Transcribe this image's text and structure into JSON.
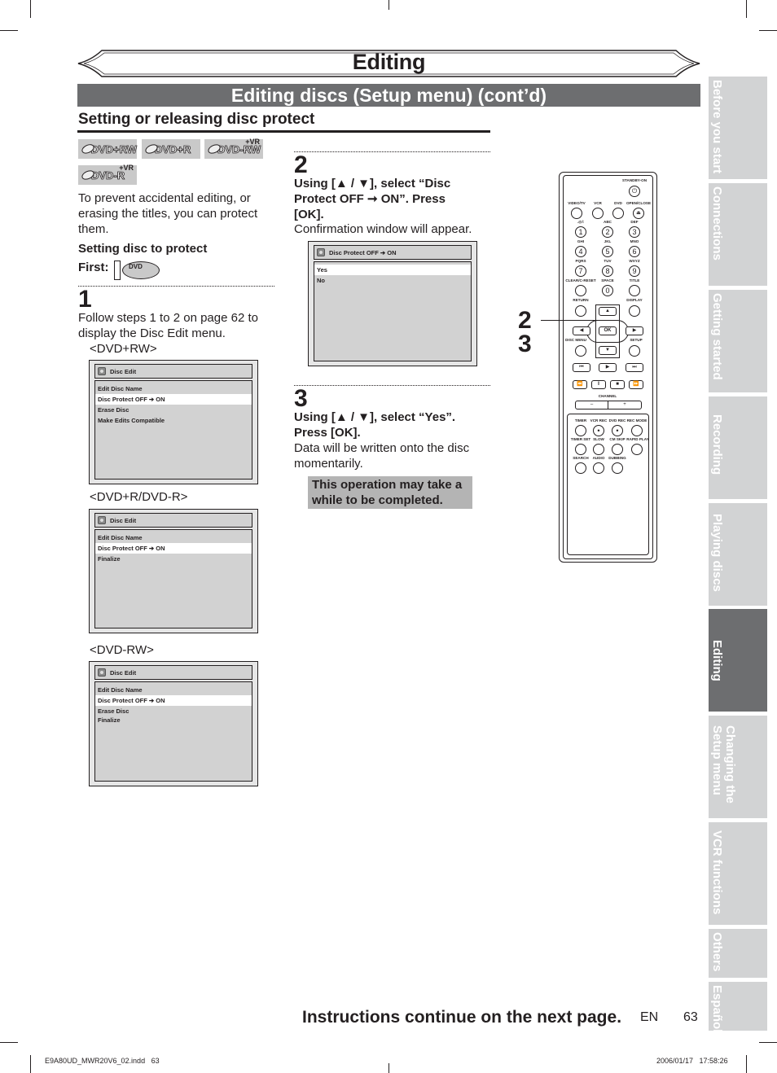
{
  "page": {
    "chapter_title": "Editing",
    "section_title": "Editing discs (Setup menu) (cont’d)",
    "subsection_title": "Setting or releasing disc protect"
  },
  "disc_badges": [
    {
      "label": "DVD+RW",
      "vr": ""
    },
    {
      "label": "DVD+R",
      "vr": ""
    },
    {
      "label": "DVD-RW",
      "vr": "+VR"
    },
    {
      "label": "DVD-R",
      "vr": "+VR"
    }
  ],
  "intro_text": "To prevent accidental editing, or erasing the titles, you can protect them.",
  "setting_heading": "Setting disc to protect",
  "first_label": "First:",
  "first_button_label": "DVD",
  "steps": [
    {
      "number": "1",
      "instruction": "Follow steps 1 to 2 on page 62 to display the Disc Edit menu."
    },
    {
      "number": "2",
      "instruction_bold": "Using [▲ / ▼], select “Disc Protect OFF ➞ ON”. Press [OK].",
      "instruction": "Confirmation window will appear."
    },
    {
      "number": "3",
      "instruction_bold": "Using [▲ / ▼], select “Yes”. Press [OK].",
      "instruction": "Data will be written onto the disc momentarily."
    }
  ],
  "screens": {
    "dvd_plus_rw": {
      "caption": "<DVD+RW>",
      "title": "Disc Edit",
      "items": [
        "Edit Disc Name",
        "Disc Protect OFF ➔ ON",
        "Erase Disc",
        "Make Edits Compatible"
      ],
      "selected_index": 1
    },
    "dvd_plus_r": {
      "caption": "<DVD+R/DVD-R>",
      "title": "Disc Edit",
      "items": [
        "Edit Disc Name",
        "Disc Protect OFF ➔ ON",
        "Finalize"
      ],
      "selected_index": 1
    },
    "dvd_minus_rw": {
      "caption": "<DVD-RW>",
      "title": "Disc Edit",
      "items": [
        "Edit Disc Name",
        "Disc Protect OFF ➔ ON",
        "Erase Disc",
        "Finalize"
      ],
      "selected_index": 1
    },
    "confirm": {
      "title": "Disc Protect OFF ➔ ON",
      "items": [
        "Yes",
        "No"
      ],
      "selected_index": 0
    }
  },
  "note": "This operation may take a while to be completed.",
  "remote": {
    "callouts": [
      "2",
      "3"
    ],
    "labels": {
      "standby": "STANDBY-ON",
      "video_tv": "VIDEO/TV",
      "vcr": "VCR",
      "dvd": "DVD",
      "open_close": "OPEN/CLOSE",
      "n1": ".@/:",
      "n2": "ABC",
      "n3": "DEF",
      "n4": "GHI",
      "n5": "JKL",
      "n6": "MNO",
      "n7": "PQRS",
      "n8": "TUV",
      "n9": "WXYZ",
      "clear": "CLEAR/C-RESET",
      "space": "SPACE",
      "title": "TITLE",
      "return": "RETURN",
      "display": "DISPLAY",
      "disc_menu": "DISC MENU",
      "setup": "SETUP",
      "ok": "OK",
      "channel": "CHANNEL",
      "minus": "–",
      "plus": "+",
      "timer": "TIMER",
      "vcr_rec": "VCR REC",
      "dvd_rec": "DVD REC",
      "rec_mode": "REC MODE",
      "timer_set": "TIMER SET",
      "slow": "SLOW",
      "cm_skip": "CM SKIP",
      "rapid_play": "RAPID PLAY",
      "search": "SEARCH",
      "audio": "AUDIO",
      "dubbing": "DUBBING"
    },
    "digits": [
      "1",
      "2",
      "3",
      "4",
      "5",
      "6",
      "7",
      "8",
      "9",
      "0"
    ]
  },
  "side_tabs": [
    {
      "label": "Before you start",
      "active": false
    },
    {
      "label": "Connections",
      "active": false
    },
    {
      "label": "Getting started",
      "active": false
    },
    {
      "label": "Recording",
      "active": false
    },
    {
      "label": "Playing discs",
      "active": false
    },
    {
      "label": "Editing",
      "active": true
    },
    {
      "label": "Changing the\nSetup menu",
      "active": false
    },
    {
      "label": "VCR functions",
      "active": false
    },
    {
      "label": "Others",
      "active": false
    },
    {
      "label": "Español",
      "active": false
    }
  ],
  "footer": {
    "continue_text": "Instructions continue on the next page.",
    "language": "EN",
    "page_number": "63",
    "slug_file": "E9A80UD_MWR20V6_02.indd   63",
    "slug_date": "2006/01/17   17:58:26"
  },
  "colors": {
    "section_bar": "#6d6e70",
    "tab_inactive": "#d2d3d4",
    "tab_active": "#6d6e70",
    "note_bg": "#b4b4b4",
    "text": "#231f20"
  }
}
